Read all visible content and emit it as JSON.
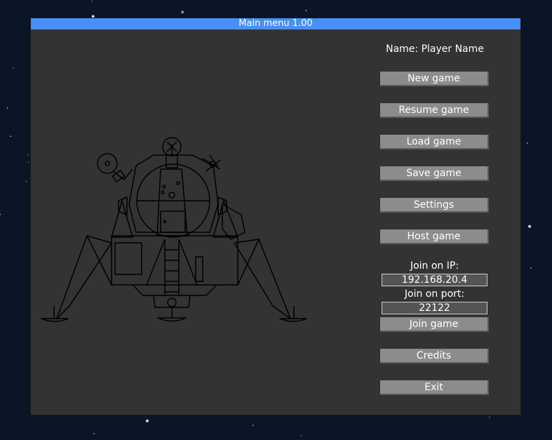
{
  "window": {
    "title": "Main menu 1.00"
  },
  "player": {
    "name_label": "Name: Player Name"
  },
  "menu": {
    "new_game": "New game",
    "resume_game": "Resume game",
    "load_game": "Load game",
    "save_game": "Save game",
    "settings": "Settings",
    "host_game": "Host game",
    "join_game": "Join game",
    "credits": "Credits",
    "exit": "Exit"
  },
  "join": {
    "ip_label": "Join on IP:",
    "ip_value": "192.168.20.4",
    "port_label": "Join on port:",
    "port_value": "22122"
  },
  "colors": {
    "titlebar": "#4a8ff5",
    "panel": "#333333",
    "button": "#8c8c8c",
    "background": "#0a1526"
  },
  "illustration": {
    "icon": "lunar-module-icon"
  }
}
